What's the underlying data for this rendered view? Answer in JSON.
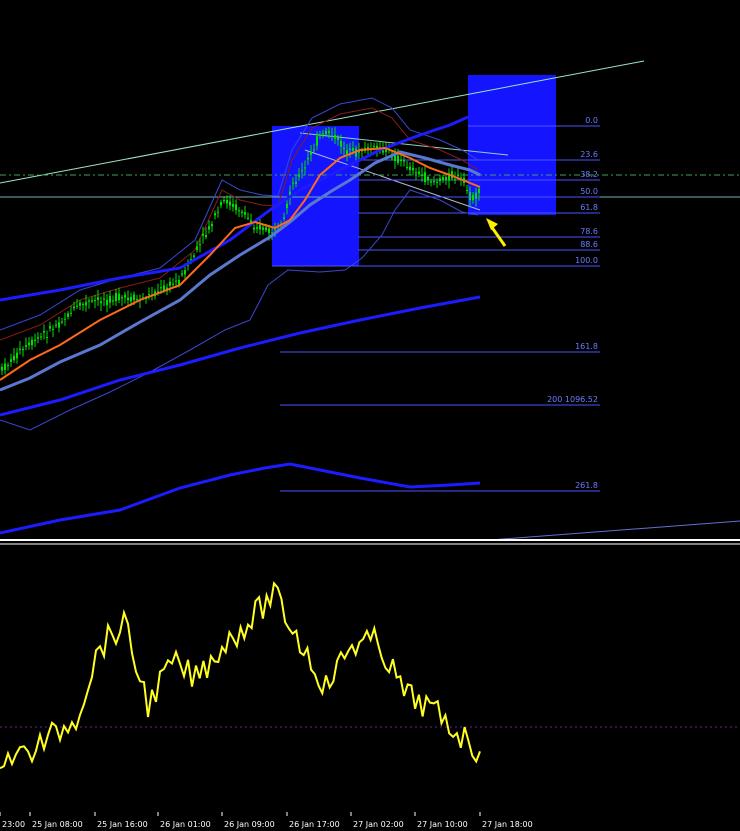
{
  "colors": {
    "background": "#000000",
    "candle": "#00e000",
    "ema_fast": "#ff6a1a",
    "ema_mid": "#5a78d0",
    "ma_slow": "#1c1cff",
    "bollinger": "#3a4cff",
    "trend": "#9fe6c8",
    "fib": "#4a55ff",
    "highlight_box": "#1414ff",
    "oscillator": "#ffff22",
    "arrow": "#ffee00",
    "separator": "#ffffff"
  },
  "fibonacci": {
    "labels": [
      "0.0",
      "23.6",
      "38.2",
      "50.0",
      "61.8",
      "78.6",
      "88.6",
      "100.0",
      "161.8",
      "200 1096.52",
      "261.8"
    ]
  },
  "time_axis": {
    "labels": [
      "23:00",
      "25 Jan 08:00",
      "25 Jan 16:00",
      "26 Jan 01:00",
      "26 Jan 09:00",
      "26 Jan 17:00",
      "27 Jan 02:00",
      "27 Jan 10:00",
      "27 Jan 18:00"
    ]
  },
  "chart_data": {
    "type": "line",
    "x": [
      "23:00",
      "25 Jan 08:00",
      "25 Jan 16:00",
      "26 Jan 01:00",
      "26 Jan 09:00",
      "26 Jan 17:00",
      "27 Jan 02:00",
      "27 Jan 10:00",
      "27 Jan 18:00"
    ],
    "fib_levels": [
      0.0,
      23.6,
      38.2,
      50.0,
      61.8,
      78.6,
      88.6,
      100.0,
      161.8,
      200,
      261.8
    ],
    "fib_200_price": 1096.52,
    "series": [
      {
        "values": [
          8,
          10,
          18,
          27,
          60,
          70,
          33,
          52,
          45,
          60,
          71,
          84,
          62,
          41,
          61,
          62,
          38,
          31,
          11
        ]
      }
    ]
  }
}
